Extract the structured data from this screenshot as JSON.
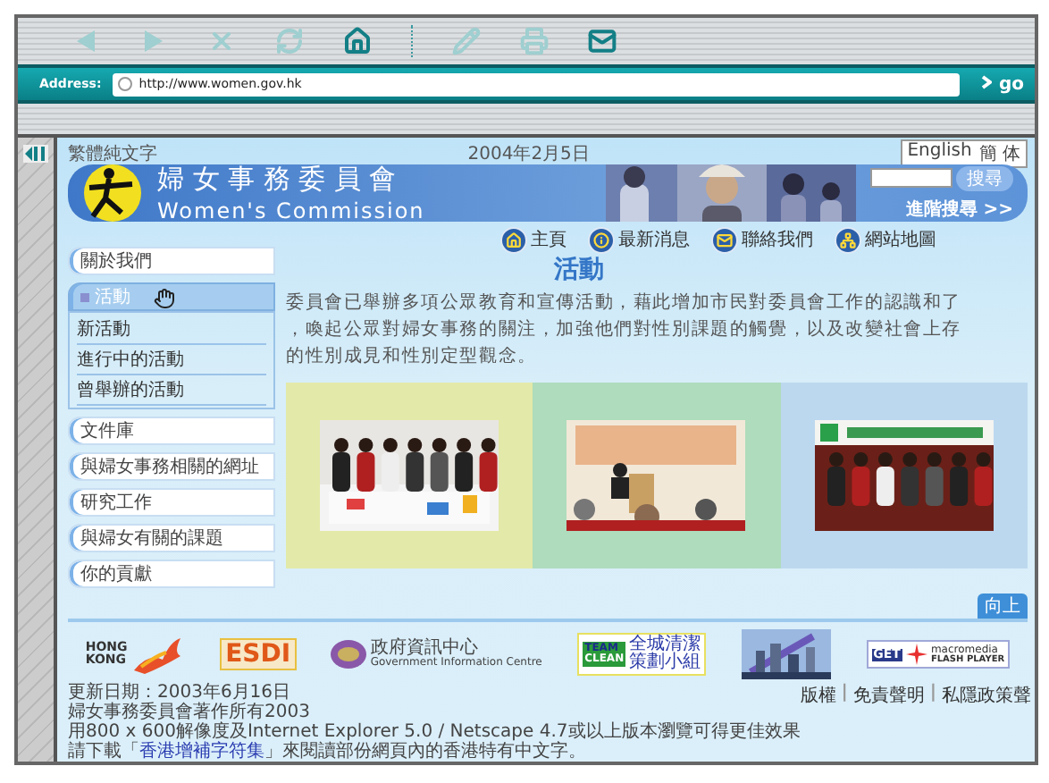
{
  "toolbar": [
    {
      "kind": "back",
      "enabled": false
    },
    {
      "kind": "forward",
      "enabled": false
    },
    {
      "kind": "stop",
      "enabled": false
    },
    {
      "kind": "refresh",
      "enabled": false
    },
    {
      "kind": "home",
      "enabled": true
    },
    {
      "kind": "separator"
    },
    {
      "kind": "edit",
      "enabled": false
    },
    {
      "kind": "print",
      "enabled": false
    },
    {
      "kind": "mail",
      "enabled": true
    }
  ],
  "address_bar": {
    "label": "Address:",
    "url": "http://www.women.gov.hk",
    "go": "go"
  },
  "top_line": {
    "text_only": "繁體純文字",
    "date": "2004年2月5日",
    "languages": [
      "English",
      "簡 体"
    ]
  },
  "banner": {
    "title_zh": "婦 女 事 務 委 員 會",
    "title_en": "Women's Commission",
    "search_button": "搜尋",
    "advanced_search": "進階搜尋 >>"
  },
  "nav": [
    {
      "kind": "home",
      "label": "主頁"
    },
    {
      "kind": "info",
      "label": "最新消息"
    },
    {
      "kind": "mail",
      "label": "聯絡我們"
    },
    {
      "kind": "sitemap",
      "label": "網站地圖"
    }
  ],
  "heading": "活動",
  "sidebar": {
    "items": [
      {
        "label": "關於我們",
        "selected": false,
        "expanded": false
      },
      {
        "label": "活動",
        "selected": true,
        "expanded": true,
        "children": [
          {
            "label": "新活動"
          },
          {
            "label": "進行中的活動"
          },
          {
            "label": "曾舉辦的活動"
          }
        ]
      },
      {
        "label": "文件庫",
        "selected": false,
        "expanded": false
      },
      {
        "label": "與婦女事務相關的網址",
        "selected": false,
        "expanded": false
      },
      {
        "label": "研究工作",
        "selected": false,
        "expanded": false
      },
      {
        "label": "與婦女有關的課題",
        "selected": false,
        "expanded": false
      },
      {
        "label": "你的貢獻",
        "selected": false,
        "expanded": false
      }
    ]
  },
  "intro_lines": [
    "委員會已舉辦多項公眾教育和宣傳活動，藉此增加市民對委員會工作的認識和了",
    "，喚起公眾對婦女事務的關注，加強他們對性別課題的觸覺，以及改變社會上存",
    "的性別成見和性別定型觀念。"
  ],
  "panels": [
    {
      "color": "#e3e9a8",
      "kind": "picture"
    },
    {
      "color": "#aedcbc",
      "kind": "picture"
    },
    {
      "color": "#bcd8ef",
      "kind": "picture"
    }
  ],
  "back_to_top": "向上",
  "logos": [
    {
      "kind": "hongkong",
      "texts": [
        "HONG",
        "KONG"
      ]
    },
    {
      "kind": "esdi",
      "texts": [
        "ESDI"
      ]
    },
    {
      "kind": "gic",
      "texts": [
        "政府資訊中心",
        "Government Information Centre"
      ]
    },
    {
      "kind": "clean",
      "texts": [
        "TEAM",
        "CLEAN",
        "全城清潔",
        "策劃小組"
      ]
    },
    {
      "kind": "city"
    },
    {
      "kind": "flash",
      "texts": [
        "GET",
        "macromedia",
        "FLASH PLAYER"
      ]
    }
  ],
  "footer_links": [
    {
      "kind": "link",
      "text": "版權"
    },
    {
      "kind": "separator",
      "text": "|"
    },
    {
      "kind": "link",
      "text": "免責聲明"
    },
    {
      "kind": "separator",
      "text": "|"
    },
    {
      "kind": "link",
      "text": "私隱政策聲"
    }
  ],
  "footer_lines": [
    {
      "text": "更新日期：2003年6月16日"
    },
    {
      "text": "婦女事務委員會著作所有2003"
    },
    {
      "text": "用800 x 600解像度及Internet Explorer 5.0 / Netscape 4.7或以上版本瀏覽可得更佳效果"
    },
    {
      "text": "請下載「",
      "link": "香港增補字符集",
      "after": "」來閱讀部份網頁內的香港特有中文字。"
    }
  ]
}
